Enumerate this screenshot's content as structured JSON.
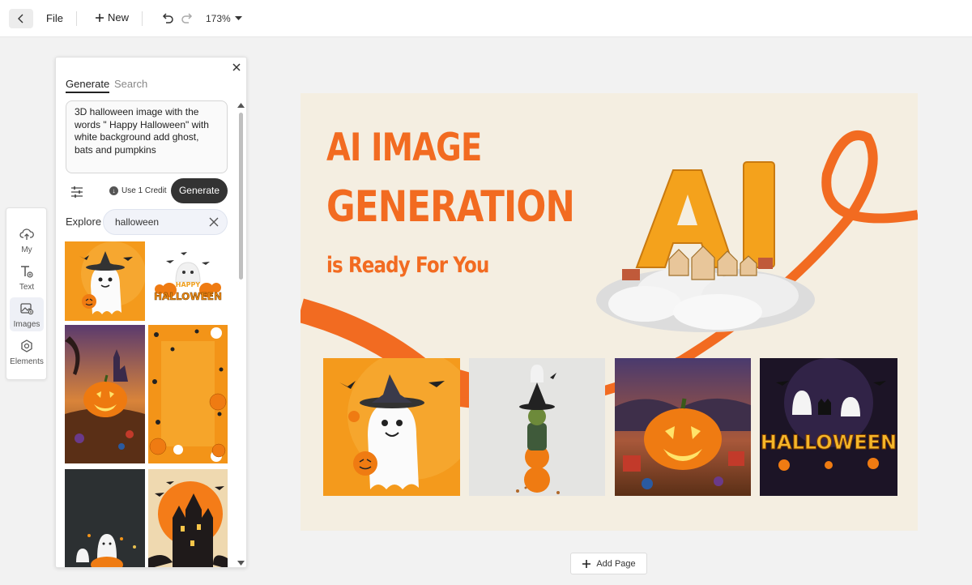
{
  "toolbar": {
    "file_label": "File",
    "new_label": "New",
    "zoom": "173%"
  },
  "rail": {
    "items": [
      {
        "label": "My",
        "icon": "cloud-upload-icon"
      },
      {
        "label": "Text",
        "icon": "text-icon"
      },
      {
        "label": "Images",
        "icon": "image-icon",
        "active": true
      },
      {
        "label": "Elements",
        "icon": "elements-icon"
      }
    ]
  },
  "panel": {
    "tabs": [
      "Generate",
      "Search"
    ],
    "prompt": "3D halloween image with the words \" Happy Halloween\" with white background add ghost, bats and pumpkins",
    "credit_label": "Use 1 Credit",
    "generate_label": "Generate",
    "explore_label": "Explore",
    "explore_value": "halloween",
    "thumbnails": [
      {
        "subject": "ghost with witch hat on orange"
      },
      {
        "subject": "Happy Halloween pumpkins on white",
        "text": "HAPPY HALLOWEEN"
      },
      {
        "subject": "jack-o-lantern at dusk with castle"
      },
      {
        "subject": "orange background with spiders and skulls"
      },
      {
        "subject": "ghosts with pumpkin on dark background"
      },
      {
        "subject": "haunted house with bats and orange moon"
      }
    ]
  },
  "canvas": {
    "headline_1": "AI IMAGE",
    "headline_2": "GENERATION",
    "subheadline": "is Ready For You",
    "logo_letters": "AI",
    "cards": [
      {
        "subject": "ghost with witch hat holding pumpkin"
      },
      {
        "subject": "witch stacked on pumpkins"
      },
      {
        "subject": "glowing jack-o-lantern"
      },
      {
        "subject": "Halloween title with ghosts and cats",
        "text": "HALLOWEEN"
      }
    ],
    "accent_color": "#f26b21",
    "background_color": "#f4eee1"
  },
  "add_page_label": "Add Page"
}
